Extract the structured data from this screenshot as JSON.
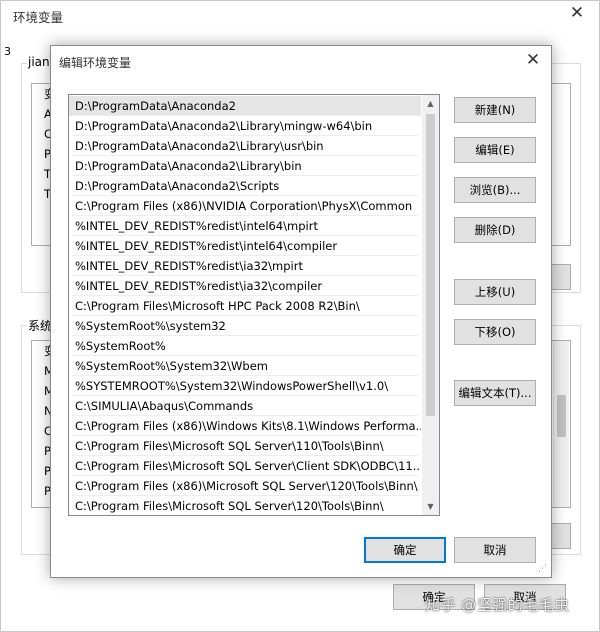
{
  "background_window": {
    "title": "环境变量",
    "user_group_label": "jiang",
    "user_list_items": [
      "变",
      "Ab",
      "On",
      "Pa",
      "TE",
      "TM"
    ],
    "system_group_label": "系统",
    "system_list_items": [
      "变",
      "M",
      "M",
      "NU",
      "OS",
      "Pa",
      "PA",
      "PR"
    ],
    "ok_label": "确定",
    "cancel_label": "取消"
  },
  "edit_dialog": {
    "title": "编辑环境变量",
    "paths": [
      "D:\\ProgramData\\Anaconda2",
      "D:\\ProgramData\\Anaconda2\\Library\\mingw-w64\\bin",
      "D:\\ProgramData\\Anaconda2\\Library\\usr\\bin",
      "D:\\ProgramData\\Anaconda2\\Library\\bin",
      "D:\\ProgramData\\Anaconda2\\Scripts",
      "C:\\Program Files (x86)\\NVIDIA Corporation\\PhysX\\Common",
      "%INTEL_DEV_REDIST%redist\\intel64\\mpirt",
      "%INTEL_DEV_REDIST%redist\\intel64\\compiler",
      "%INTEL_DEV_REDIST%redist\\ia32\\mpirt",
      "%INTEL_DEV_REDIST%redist\\ia32\\compiler",
      "C:\\Program Files\\Microsoft HPC Pack 2008 R2\\Bin\\",
      "%SystemRoot%\\system32",
      "%SystemRoot%",
      "%SystemRoot%\\System32\\Wbem",
      "%SYSTEMROOT%\\System32\\WindowsPowerShell\\v1.0\\",
      "C:\\SIMULIA\\Abaqus\\Commands",
      "C:\\Program Files (x86)\\Windows Kits\\8.1\\Windows Performa...",
      "C:\\Program Files\\Microsoft SQL Server\\110\\Tools\\Binn\\",
      "C:\\Program Files\\Microsoft SQL Server\\Client SDK\\ODBC\\11...",
      "C:\\Program Files (x86)\\Microsoft SQL Server\\120\\Tools\\Binn\\",
      "C:\\Program Files\\Microsoft SQL Server\\120\\Tools\\Binn\\"
    ],
    "buttons": {
      "new": "新建(N)",
      "edit": "编辑(E)",
      "browse": "浏览(B)...",
      "delete": "删除(D)",
      "move_up": "上移(U)",
      "move_down": "下移(O)",
      "edit_text": "编辑文本(T)..."
    },
    "ok_label": "确定",
    "cancel_label": "取消"
  },
  "watermark": "知乎 @坚强的毛毛虫"
}
